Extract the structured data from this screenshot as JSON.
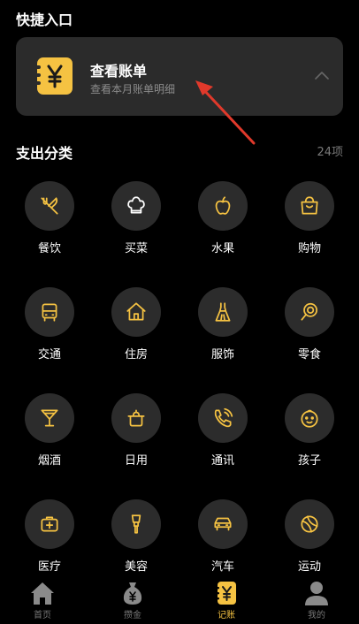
{
  "quick": {
    "title": "快捷入口",
    "card_title": "查看账单",
    "card_subtitle": "查看本月账单明细",
    "card_icon": "yen-ledger-icon"
  },
  "categories": {
    "title": "支出分类",
    "count": "24项",
    "items": [
      {
        "label": "餐饮",
        "icon": "dining-icon"
      },
      {
        "label": "买菜",
        "icon": "chef-hat-icon"
      },
      {
        "label": "水果",
        "icon": "apple-icon"
      },
      {
        "label": "购物",
        "icon": "shopping-bag-icon"
      },
      {
        "label": "交通",
        "icon": "bus-icon"
      },
      {
        "label": "住房",
        "icon": "house-icon"
      },
      {
        "label": "服饰",
        "icon": "dress-icon"
      },
      {
        "label": "零食",
        "icon": "lollipop-icon"
      },
      {
        "label": "烟酒",
        "icon": "cocktail-icon"
      },
      {
        "label": "日用",
        "icon": "pot-icon"
      },
      {
        "label": "通讯",
        "icon": "phone-icon"
      },
      {
        "label": "孩子",
        "icon": "baby-icon"
      },
      {
        "label": "医疗",
        "icon": "medical-kit-icon"
      },
      {
        "label": "美容",
        "icon": "beauty-icon"
      },
      {
        "label": "汽车",
        "icon": "car-icon"
      },
      {
        "label": "运动",
        "icon": "ball-icon"
      }
    ]
  },
  "tabs": [
    {
      "label": "首页",
      "icon": "home-icon",
      "active": false
    },
    {
      "label": "攒金",
      "icon": "money-bag-icon",
      "active": false
    },
    {
      "label": "记账",
      "icon": "ledger-icon",
      "active": true
    },
    {
      "label": "我的",
      "icon": "user-icon",
      "active": false
    }
  ],
  "colors": {
    "accent": "#f5c242",
    "background": "#000000",
    "card": "#2b2b2b",
    "circle": "#2c2c2c",
    "annotation_arrow": "#e0392b"
  }
}
